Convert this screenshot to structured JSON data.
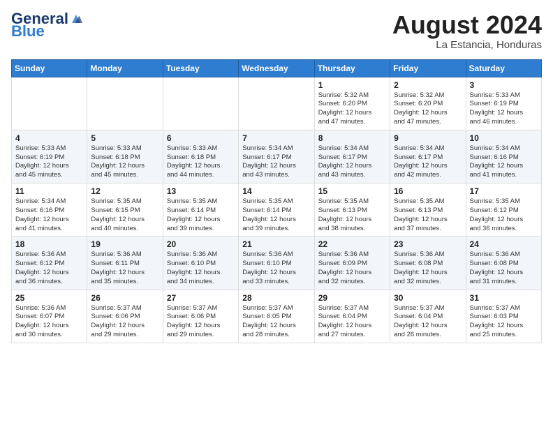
{
  "header": {
    "logo_general": "General",
    "logo_blue": "Blue",
    "month_year": "August 2024",
    "location": "La Estancia, Honduras"
  },
  "weekdays": [
    "Sunday",
    "Monday",
    "Tuesday",
    "Wednesday",
    "Thursday",
    "Friday",
    "Saturday"
  ],
  "weeks": [
    [
      {
        "day": "",
        "info": ""
      },
      {
        "day": "",
        "info": ""
      },
      {
        "day": "",
        "info": ""
      },
      {
        "day": "",
        "info": ""
      },
      {
        "day": "1",
        "info": "Sunrise: 5:32 AM\nSunset: 6:20 PM\nDaylight: 12 hours\nand 47 minutes."
      },
      {
        "day": "2",
        "info": "Sunrise: 5:32 AM\nSunset: 6:20 PM\nDaylight: 12 hours\nand 47 minutes."
      },
      {
        "day": "3",
        "info": "Sunrise: 5:33 AM\nSunset: 6:19 PM\nDaylight: 12 hours\nand 46 minutes."
      }
    ],
    [
      {
        "day": "4",
        "info": "Sunrise: 5:33 AM\nSunset: 6:19 PM\nDaylight: 12 hours\nand 45 minutes."
      },
      {
        "day": "5",
        "info": "Sunrise: 5:33 AM\nSunset: 6:18 PM\nDaylight: 12 hours\nand 45 minutes."
      },
      {
        "day": "6",
        "info": "Sunrise: 5:33 AM\nSunset: 6:18 PM\nDaylight: 12 hours\nand 44 minutes."
      },
      {
        "day": "7",
        "info": "Sunrise: 5:34 AM\nSunset: 6:17 PM\nDaylight: 12 hours\nand 43 minutes."
      },
      {
        "day": "8",
        "info": "Sunrise: 5:34 AM\nSunset: 6:17 PM\nDaylight: 12 hours\nand 43 minutes."
      },
      {
        "day": "9",
        "info": "Sunrise: 5:34 AM\nSunset: 6:17 PM\nDaylight: 12 hours\nand 42 minutes."
      },
      {
        "day": "10",
        "info": "Sunrise: 5:34 AM\nSunset: 6:16 PM\nDaylight: 12 hours\nand 41 minutes."
      }
    ],
    [
      {
        "day": "11",
        "info": "Sunrise: 5:34 AM\nSunset: 6:16 PM\nDaylight: 12 hours\nand 41 minutes."
      },
      {
        "day": "12",
        "info": "Sunrise: 5:35 AM\nSunset: 6:15 PM\nDaylight: 12 hours\nand 40 minutes."
      },
      {
        "day": "13",
        "info": "Sunrise: 5:35 AM\nSunset: 6:14 PM\nDaylight: 12 hours\nand 39 minutes."
      },
      {
        "day": "14",
        "info": "Sunrise: 5:35 AM\nSunset: 6:14 PM\nDaylight: 12 hours\nand 39 minutes."
      },
      {
        "day": "15",
        "info": "Sunrise: 5:35 AM\nSunset: 6:13 PM\nDaylight: 12 hours\nand 38 minutes."
      },
      {
        "day": "16",
        "info": "Sunrise: 5:35 AM\nSunset: 6:13 PM\nDaylight: 12 hours\nand 37 minutes."
      },
      {
        "day": "17",
        "info": "Sunrise: 5:35 AM\nSunset: 6:12 PM\nDaylight: 12 hours\nand 36 minutes."
      }
    ],
    [
      {
        "day": "18",
        "info": "Sunrise: 5:36 AM\nSunset: 6:12 PM\nDaylight: 12 hours\nand 36 minutes."
      },
      {
        "day": "19",
        "info": "Sunrise: 5:36 AM\nSunset: 6:11 PM\nDaylight: 12 hours\nand 35 minutes."
      },
      {
        "day": "20",
        "info": "Sunrise: 5:36 AM\nSunset: 6:10 PM\nDaylight: 12 hours\nand 34 minutes."
      },
      {
        "day": "21",
        "info": "Sunrise: 5:36 AM\nSunset: 6:10 PM\nDaylight: 12 hours\nand 33 minutes."
      },
      {
        "day": "22",
        "info": "Sunrise: 5:36 AM\nSunset: 6:09 PM\nDaylight: 12 hours\nand 32 minutes."
      },
      {
        "day": "23",
        "info": "Sunrise: 5:36 AM\nSunset: 6:08 PM\nDaylight: 12 hours\nand 32 minutes."
      },
      {
        "day": "24",
        "info": "Sunrise: 5:36 AM\nSunset: 6:08 PM\nDaylight: 12 hours\nand 31 minutes."
      }
    ],
    [
      {
        "day": "25",
        "info": "Sunrise: 5:36 AM\nSunset: 6:07 PM\nDaylight: 12 hours\nand 30 minutes."
      },
      {
        "day": "26",
        "info": "Sunrise: 5:37 AM\nSunset: 6:06 PM\nDaylight: 12 hours\nand 29 minutes."
      },
      {
        "day": "27",
        "info": "Sunrise: 5:37 AM\nSunset: 6:06 PM\nDaylight: 12 hours\nand 29 minutes."
      },
      {
        "day": "28",
        "info": "Sunrise: 5:37 AM\nSunset: 6:05 PM\nDaylight: 12 hours\nand 28 minutes."
      },
      {
        "day": "29",
        "info": "Sunrise: 5:37 AM\nSunset: 6:04 PM\nDaylight: 12 hours\nand 27 minutes."
      },
      {
        "day": "30",
        "info": "Sunrise: 5:37 AM\nSunset: 6:04 PM\nDaylight: 12 hours\nand 26 minutes."
      },
      {
        "day": "31",
        "info": "Sunrise: 5:37 AM\nSunset: 6:03 PM\nDaylight: 12 hours\nand 25 minutes."
      }
    ]
  ]
}
